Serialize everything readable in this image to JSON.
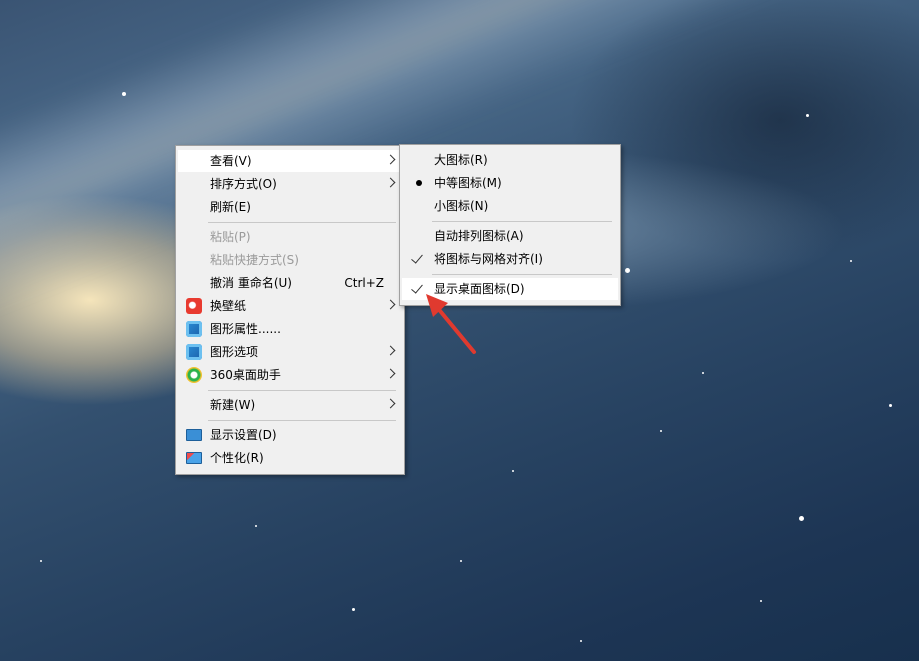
{
  "context_menu": {
    "items": [
      {
        "label": "查看(V)"
      },
      {
        "label": "排序方式(O)"
      },
      {
        "label": "刷新(E)"
      },
      {
        "label": "粘贴(P)"
      },
      {
        "label": "粘贴快捷方式(S)"
      },
      {
        "label": "撤消 重命名(U)",
        "shortcut": "Ctrl+Z"
      },
      {
        "label": "换壁纸",
        "icon": "wallpaper-app-icon"
      },
      {
        "label": "图形属性......",
        "icon": "graphics-properties-icon"
      },
      {
        "label": "图形选项",
        "icon": "graphics-options-icon"
      },
      {
        "label": "360桌面助手",
        "icon": "360-desktop-assistant-icon"
      },
      {
        "label": "新建(W)"
      },
      {
        "label": "显示设置(D)",
        "icon": "display-settings-icon"
      },
      {
        "label": "个性化(R)",
        "icon": "personalize-icon"
      }
    ]
  },
  "view_submenu": {
    "items": [
      {
        "label": "大图标(R)"
      },
      {
        "label": "中等图标(M)",
        "state": "selected-bullet"
      },
      {
        "label": "小图标(N)"
      },
      {
        "label": "自动排列图标(A)"
      },
      {
        "label": "将图标与网格对齐(I)",
        "state": "checked"
      },
      {
        "label": "显示桌面图标(D)",
        "state": "checked"
      }
    ]
  },
  "colors": {
    "menu_bg": "#f0f0f0",
    "highlight": "#ffffff",
    "annotation_arrow": "#e03a2f"
  }
}
